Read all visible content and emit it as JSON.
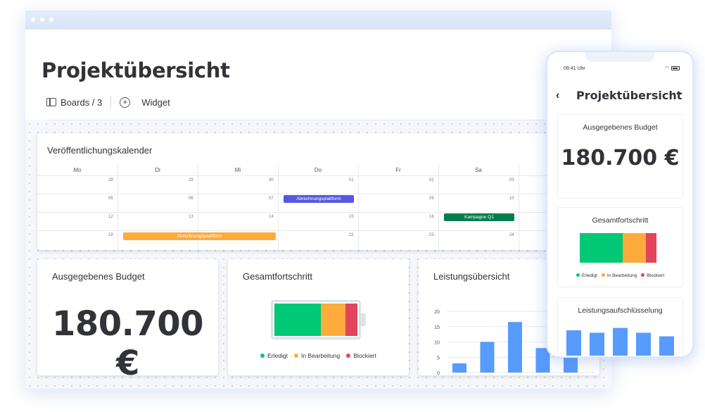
{
  "desktop": {
    "title": "Projektübersicht",
    "toolbar": {
      "boards_label": "Boards / 3",
      "widget_label": "Widget"
    },
    "calendar": {
      "title": "Veröffentlichungskalender",
      "days": [
        "Mo",
        "Di",
        "Mi",
        "Do",
        "Fr",
        "Sa"
      ],
      "weeks": [
        [
          "28",
          "29",
          "30",
          "01",
          "02",
          "03"
        ],
        [
          "05",
          "06",
          "07",
          "08",
          "09",
          "10"
        ],
        [
          "12",
          "13",
          "14",
          "15",
          "16",
          "17"
        ],
        [
          "19",
          "20",
          "21",
          "22",
          "23",
          "24"
        ]
      ],
      "events": [
        {
          "label": "Abrechnungsplattform",
          "color": "#5559df"
        },
        {
          "label": "Kampagne Q1",
          "color": "#037f4c"
        },
        {
          "label": "Abrechnungsplattform",
          "color": "#fdab3d"
        }
      ]
    },
    "budget": {
      "title": "Ausgegebenes Budget",
      "value": "180.700 €"
    },
    "progress": {
      "title": "Gesamtfortschritt",
      "segments": [
        {
          "label": "Erledigt",
          "fraction": 0.56,
          "color": "#00c875"
        },
        {
          "label": "In Bearbeitung",
          "fraction": 0.3,
          "color": "#fdab3d"
        },
        {
          "label": "Blockiert",
          "fraction": 0.14,
          "color": "#e2445c"
        }
      ]
    },
    "performance": {
      "title": "Leistungsübersicht"
    }
  },
  "phone": {
    "status_time": "09:41 Uhr",
    "title": "Projektübersicht",
    "back_label": "‹",
    "more_label": "···",
    "budget": {
      "title": "Ausgegebenes Budget",
      "value": "180.700 €"
    },
    "progress": {
      "title": "Gesamtfortschritt"
    },
    "breakdown": {
      "title": "Leistungsaufschlüsselung"
    }
  },
  "chart_data": [
    {
      "type": "bar",
      "title": "Leistungsübersicht",
      "xlabel": "",
      "ylabel": "",
      "ylim": [
        0,
        20
      ],
      "yticks": [
        0,
        5,
        10,
        15,
        20
      ],
      "grid": true,
      "values": [
        3,
        10,
        16.5,
        8,
        6
      ],
      "color": "#579bfc"
    },
    {
      "type": "bar",
      "title": "Leistungsaufschlüsselung",
      "values": [
        10.5,
        9.5,
        11.5,
        9.5,
        8
      ],
      "ylim": [
        0,
        14
      ],
      "color": "#579bfc"
    }
  ]
}
